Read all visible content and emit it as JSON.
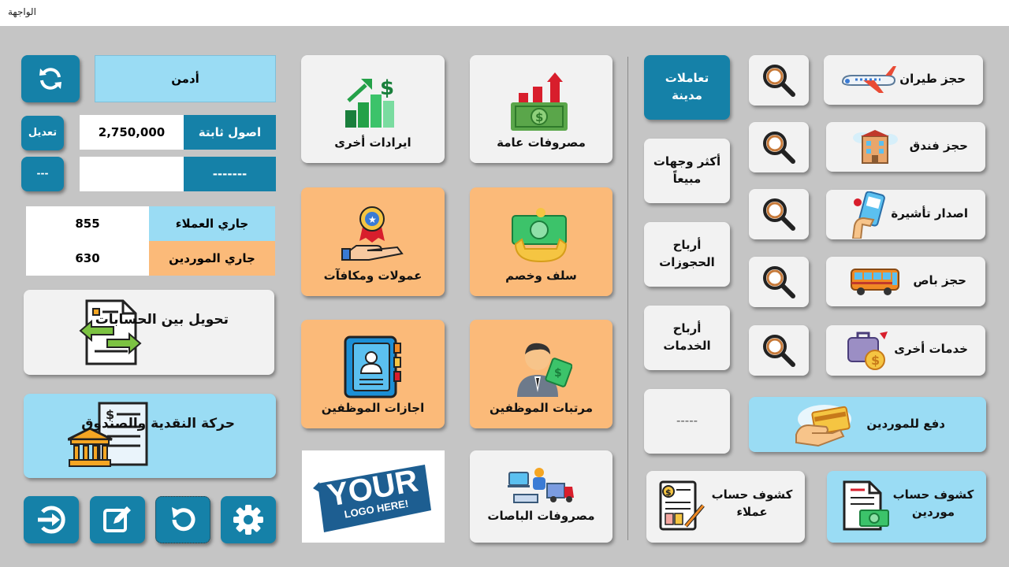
{
  "window": {
    "title": "الواجهة"
  },
  "user": {
    "name": "أدمن"
  },
  "assets": {
    "label": "اصول ثابتة",
    "value": "2,750,000",
    "edit_label": "تعديل"
  },
  "placeholder_row": {
    "label": "-------",
    "value": "",
    "button_label": "---"
  },
  "balances": [
    {
      "label": "جاري العملاء",
      "value": "855"
    },
    {
      "label": "جاري الموردين",
      "value": "630"
    }
  ],
  "left_cards": {
    "transfer": "تحويل بين الحسابات",
    "cash": "حركة النقدية والصندوق"
  },
  "middle_cards": {
    "other_revenue": "ايرادات أخرى",
    "general_expenses": "مصروفات عامة",
    "commissions": "عمولات ومكافآت",
    "advances": "سلف وخصم",
    "vacations": "اجازات الموظفين",
    "salaries": "مرتبات الموظفين",
    "bus_expenses": "مصروفات الباصات",
    "logo_main": "YOUR",
    "logo_sub": "LOGO HERE!"
  },
  "right_column": {
    "credit_transactions": "تعاملات مدينة",
    "best_selling": "أكثر وجهات مبيعاً",
    "booking_profits": "أرباح الحجوزات",
    "service_profits": "أرباح الخدمات",
    "empty": "-----"
  },
  "services": [
    {
      "label": "حجز طيران"
    },
    {
      "label": "حجز فندق"
    },
    {
      "label": "اصدار تأشيرة"
    },
    {
      "label": "حجز باص"
    },
    {
      "label": "خدمات أخرى"
    }
  ],
  "supplier_payment": "دفع للموردين",
  "statements": {
    "customers": "كشوف حساب عملاء",
    "suppliers": "كشوف حساب موردين"
  },
  "colors": {
    "accent": "#1581a8",
    "light": "#9adcf4",
    "orange": "#fbba79",
    "card": "#f2f2f2",
    "background": "#c5c5c5"
  }
}
